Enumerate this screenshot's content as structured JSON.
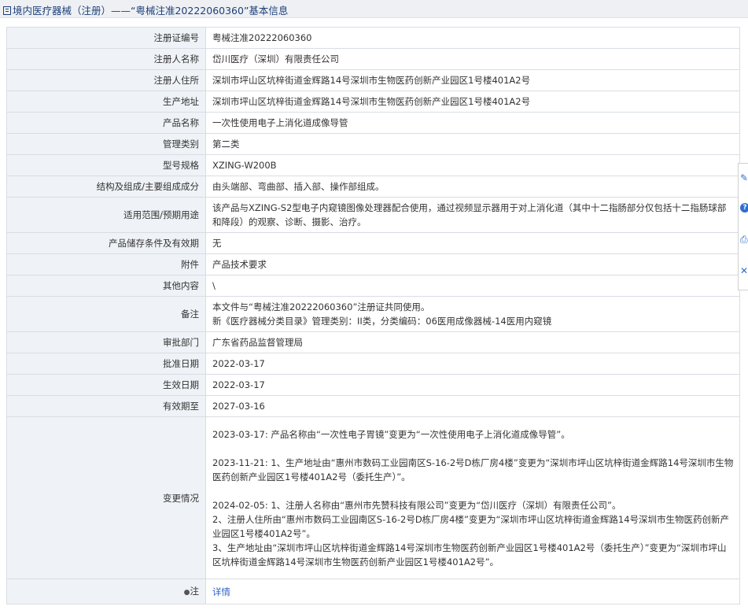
{
  "header": {
    "title": "境内医疗器械（注册）——“粤械注准20222060360”基本信息"
  },
  "rows": [
    {
      "label": "注册证编号",
      "value": "粤械注准20222060360"
    },
    {
      "label": "注册人名称",
      "value": "岱川医疗（深圳）有限责任公司"
    },
    {
      "label": "注册人住所",
      "value": "深圳市坪山区坑梓街道金辉路14号深圳市生物医药创新产业园区1号楼401A2号"
    },
    {
      "label": "生产地址",
      "value": "深圳市坪山区坑梓街道金辉路14号深圳市生物医药创新产业园区1号楼401A2号"
    },
    {
      "label": "产品名称",
      "value": "一次性使用电子上消化道成像导管"
    },
    {
      "label": "管理类别",
      "value": "第二类"
    },
    {
      "label": "型号规格",
      "value": "XZING-W200B"
    },
    {
      "label": "结构及组成/主要组成成分",
      "value": "由头端部、弯曲部、插入部、操作部组成。"
    },
    {
      "label": "适用范围/预期用途",
      "value": "该产品与XZING-S2型电子内窥镜图像处理器配合使用，通过视频显示器用于对上消化道（其中十二指肠部分仅包括十二指肠球部和降段）的观察、诊断、摄影、治疗。"
    },
    {
      "label": "产品储存条件及有效期",
      "value": "无"
    },
    {
      "label": "附件",
      "value": "产品技术要求"
    },
    {
      "label": "其他内容",
      "value": "\\"
    },
    {
      "label": "备注",
      "lines": [
        "本文件与“粤械注准20222060360”注册证共同使用。",
        "新《医疗器械分类目录》管理类别：II类，分类编码：06医用成像器械-14医用内窥镜"
      ]
    },
    {
      "label": "审批部门",
      "value": "广东省药品监督管理局"
    },
    {
      "label": "批准日期",
      "value": "2022-03-17"
    },
    {
      "label": "生效日期",
      "value": "2022-03-17"
    },
    {
      "label": "有效期至",
      "value": "2027-03-16"
    },
    {
      "label": "变更情况",
      "paragraphs": [
        "2023-03-17: 产品名称由“一次性电子胃镜”变更为“一次性使用电子上消化道成像导管”。",
        "2023-11-21: 1、生产地址由“惠州市数码工业园南区S-16-2号D栋厂房4楼”变更为“深圳市坪山区坑梓街道金辉路14号深圳市生物医药创新产业园区1号楼401A2号（委托生产）”。",
        "2024-02-05: 1、注册人名称由“惠州市先赞科技有限公司”变更为“岱川医疗（深圳）有限责任公司”。\n2、注册人住所由“惠州市数码工业园南区S-16-2号D栋厂房4楼”变更为“深圳市坪山区坑梓街道金辉路14号深圳市生物医药创新产业园区1号楼401A2号”。\n3、生产地址由“深圳市坪山区坑梓街道金辉路14号深圳市生物医药创新产业园区1号楼401A2号（委托生产）”变更为“深圳市坪山区坑梓街道金辉路14号深圳市生物医药创新产业园区1号楼401A2号”。"
      ]
    },
    {
      "label": "注",
      "value": "详情"
    }
  ],
  "side_tools": [
    "edit-icon",
    "help-icon",
    "print-icon",
    "close-icon"
  ]
}
